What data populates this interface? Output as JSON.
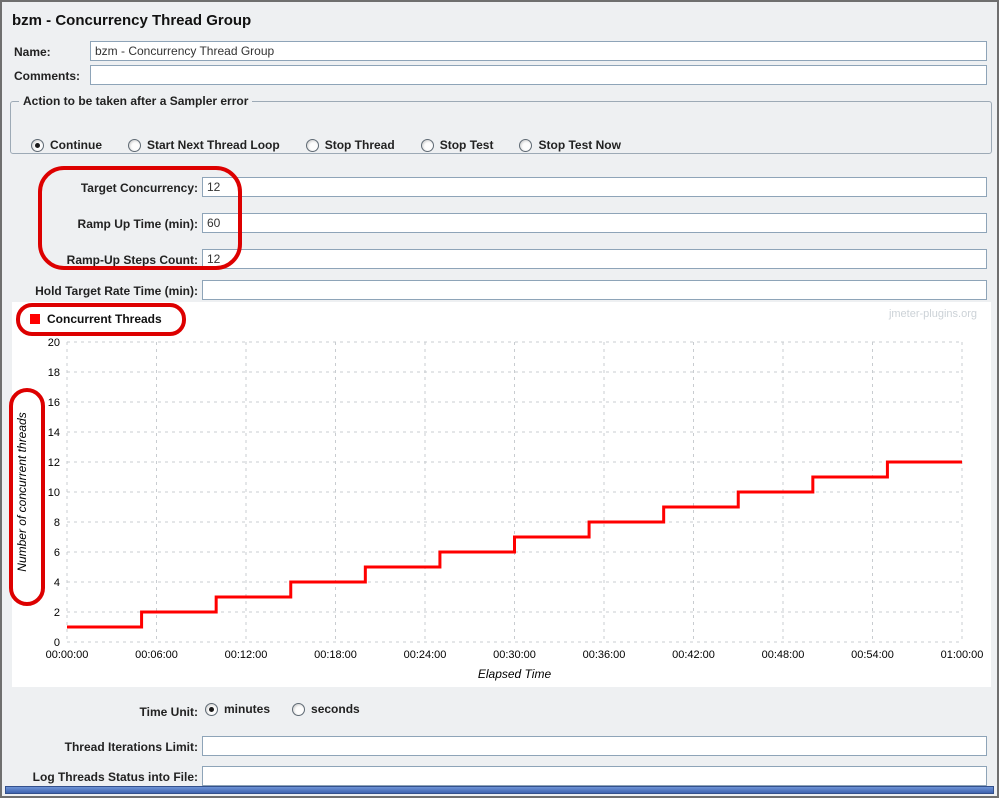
{
  "title": "bzm - Concurrency Thread Group",
  "annotation_color": "#dd0000",
  "fields": {
    "name": {
      "label": "Name:",
      "value": "bzm - Concurrency Thread Group"
    },
    "comments": {
      "label": "Comments:",
      "value": ""
    },
    "target_concurrency": {
      "label": "Target Concurrency:",
      "value": "12"
    },
    "ramp_up_time": {
      "label": "Ramp Up Time (min):",
      "value": "60"
    },
    "ramp_up_steps_count": {
      "label": "Ramp-Up Steps Count:",
      "value": "12"
    },
    "hold_target_rate_time": {
      "label": "Hold Target Rate Time (min):",
      "value": ""
    },
    "thread_iterations_limit": {
      "label": "Thread Iterations Limit:",
      "value": ""
    },
    "log_threads_status_file": {
      "label": "Log Threads Status into File:",
      "value": ""
    }
  },
  "sampler_error": {
    "legend": "Action to be taken after a Sampler error",
    "options": [
      {
        "label": "Continue",
        "selected": true
      },
      {
        "label": "Start Next Thread Loop",
        "selected": false
      },
      {
        "label": "Stop Thread",
        "selected": false
      },
      {
        "label": "Stop Test",
        "selected": false
      },
      {
        "label": "Stop Test Now",
        "selected": false
      }
    ]
  },
  "time_unit": {
    "label": "Time Unit:",
    "options": [
      {
        "label": "minutes",
        "selected": true
      },
      {
        "label": "seconds",
        "selected": false
      }
    ]
  },
  "chart_data": {
    "type": "line",
    "legend": "Concurrent Threads",
    "watermark": "jmeter-plugins.org",
    "xlabel": "Elapsed Time",
    "ylabel": "Number of concurrent threads",
    "x_ticks": [
      "00:00:00",
      "00:06:00",
      "00:12:00",
      "00:18:00",
      "00:24:00",
      "00:30:00",
      "00:36:00",
      "00:42:00",
      "00:48:00",
      "00:54:00",
      "01:00:00"
    ],
    "y_ticks": [
      0,
      2,
      4,
      6,
      8,
      10,
      12,
      14,
      16,
      18,
      20
    ],
    "ylim": [
      0,
      20
    ],
    "xlim_minutes": [
      0,
      60
    ],
    "grid": true,
    "series": [
      {
        "name": "Concurrent Threads",
        "color": "#ff0000",
        "steps_minutes": [
          [
            0,
            1
          ],
          [
            5,
            2
          ],
          [
            10,
            3
          ],
          [
            15,
            4
          ],
          [
            20,
            5
          ],
          [
            25,
            6
          ],
          [
            30,
            7
          ],
          [
            35,
            8
          ],
          [
            40,
            9
          ],
          [
            45,
            10
          ],
          [
            50,
            11
          ],
          [
            55,
            12
          ]
        ],
        "end_minute": 60
      }
    ]
  }
}
